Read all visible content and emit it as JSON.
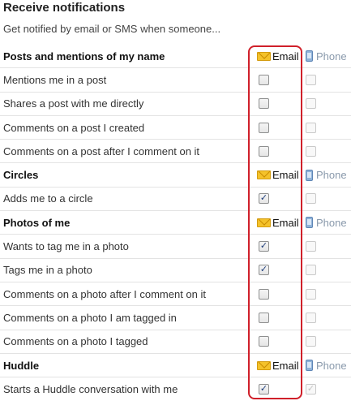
{
  "header": {
    "title": "Receive notifications",
    "subtitle": "Get notified by email or SMS when someone..."
  },
  "columns": {
    "email_label": "Email",
    "phone_label": "Phone"
  },
  "colors": {
    "highlight": "#d0202a",
    "envelope": "#f4c22a",
    "phone_icon": "#8fb2d8"
  },
  "sections": [
    {
      "title": "Posts and mentions of my name",
      "items": [
        {
          "label": "Mentions me in a post",
          "email": false,
          "phone": false
        },
        {
          "label": "Shares a post with me directly",
          "email": false,
          "phone": false
        },
        {
          "label": "Comments on a post I created",
          "email": false,
          "phone": false
        },
        {
          "label": "Comments on a post after I comment on it",
          "email": false,
          "phone": false
        }
      ]
    },
    {
      "title": "Circles",
      "items": [
        {
          "label": "Adds me to a circle",
          "email": true,
          "phone": false
        }
      ]
    },
    {
      "title": "Photos of me",
      "items": [
        {
          "label": "Wants to tag me in a photo",
          "email": true,
          "phone": false
        },
        {
          "label": "Tags me in a photo",
          "email": true,
          "phone": false
        },
        {
          "label": "Comments on a photo after I comment on it",
          "email": false,
          "phone": false
        },
        {
          "label": "Comments on a photo I am tagged in",
          "email": false,
          "phone": false
        },
        {
          "label": "Comments on a photo I tagged",
          "email": false,
          "phone": false
        }
      ]
    },
    {
      "title": "Huddle",
      "items": [
        {
          "label": "Starts a Huddle conversation with me",
          "email": true,
          "phone": true
        }
      ]
    }
  ]
}
